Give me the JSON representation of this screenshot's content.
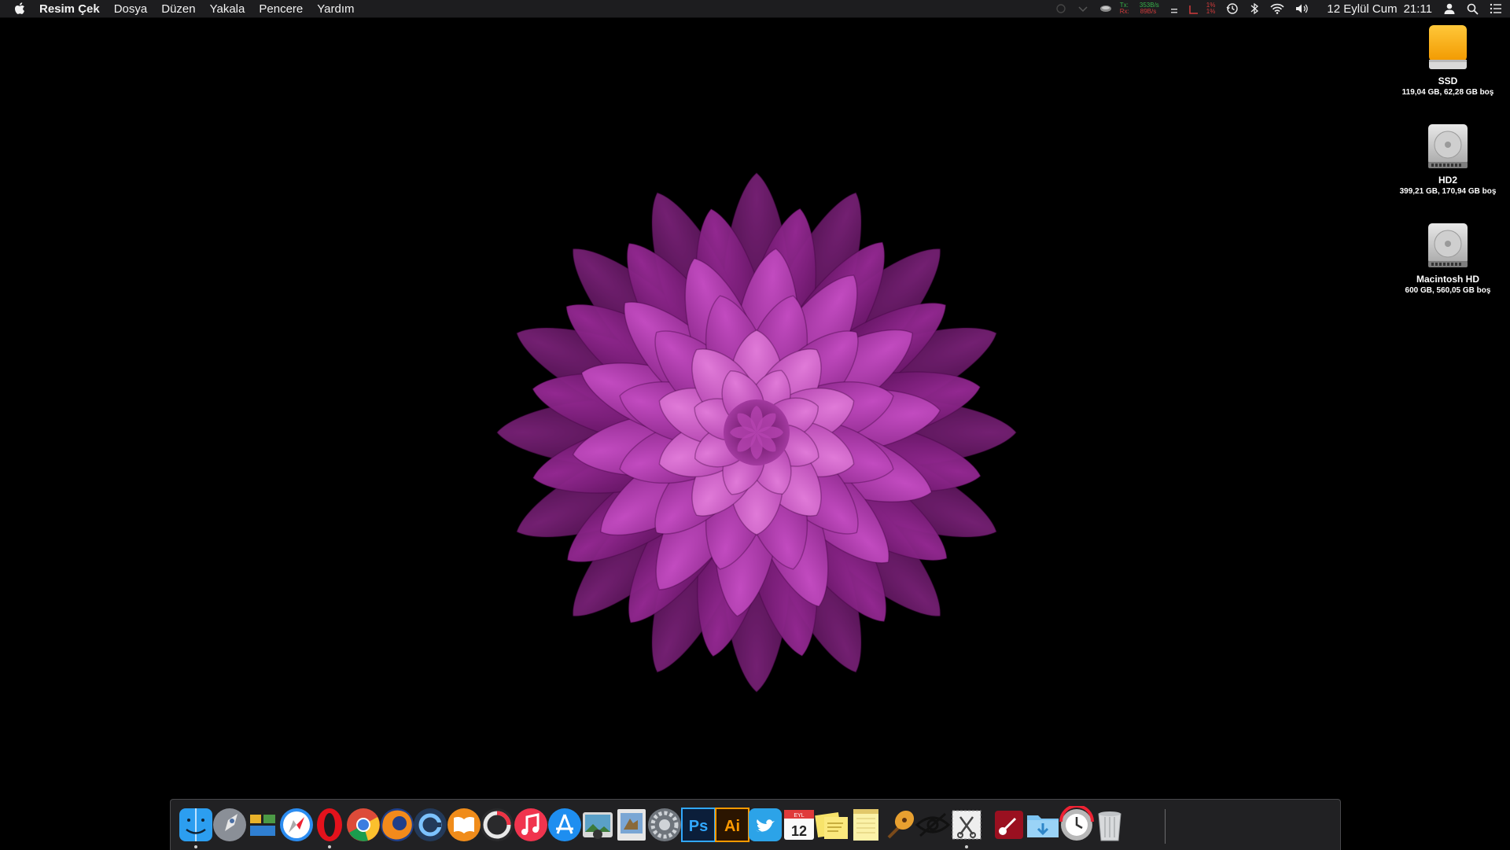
{
  "menubar": {
    "app_name": "Resim Çek",
    "items": [
      "Dosya",
      "Düzen",
      "Yakala",
      "Pencere",
      "Yardım"
    ],
    "network": {
      "tx_label": "Tx:",
      "rx_label": "Rx:",
      "tx_value": "353B/s",
      "rx_value": "89B/s"
    },
    "cpu": {
      "line1": "1%",
      "line2": "1%"
    },
    "date": "12 Eylül Cum",
    "time": "21:11"
  },
  "desktop": {
    "drives": [
      {
        "name": "SSD",
        "info": "119,04 GB, 62,28 GB boş",
        "icon": "external-drive-icon"
      },
      {
        "name": "HD2",
        "info": "399,21 GB, 170,94 GB boş",
        "icon": "hard-drive-icon"
      },
      {
        "name": "Macintosh HD",
        "info": "600 GB, 560,05 GB boş",
        "icon": "hard-drive-icon"
      }
    ]
  },
  "dock": {
    "apps": [
      {
        "name": "Finder",
        "icon": "finder-icon",
        "running": true
      },
      {
        "name": "Launchpad",
        "icon": "launchpad-icon",
        "running": false
      },
      {
        "name": "Mission Control",
        "icon": "mission-control-icon",
        "running": false
      },
      {
        "name": "Safari",
        "icon": "safari-icon",
        "running": false
      },
      {
        "name": "Opera",
        "icon": "opera-icon",
        "running": true
      },
      {
        "name": "Chrome",
        "icon": "chrome-icon",
        "running": false
      },
      {
        "name": "Firefox",
        "icon": "firefox-icon",
        "running": false
      },
      {
        "name": "Web Browser",
        "icon": "browser-icon",
        "running": false
      },
      {
        "name": "iBooks",
        "icon": "ibooks-icon",
        "running": false
      },
      {
        "name": "Music Player",
        "icon": "music-player-icon",
        "running": false
      },
      {
        "name": "iTunes",
        "icon": "itunes-icon",
        "running": false
      },
      {
        "name": "App Store",
        "icon": "app-store-icon",
        "running": false
      },
      {
        "name": "Image Capture",
        "icon": "image-capture-icon",
        "running": false
      },
      {
        "name": "Preview",
        "icon": "preview-icon",
        "running": false
      },
      {
        "name": "System Preferences",
        "icon": "system-preferences-icon",
        "running": false
      },
      {
        "name": "Photoshop",
        "icon": "photoshop-icon",
        "running": false,
        "label": "Ps"
      },
      {
        "name": "Illustrator",
        "icon": "illustrator-icon",
        "running": false,
        "label": "Ai"
      },
      {
        "name": "Twitter",
        "icon": "twitter-icon",
        "running": false
      },
      {
        "name": "Calendar",
        "icon": "calendar-icon",
        "running": false,
        "label": "12",
        "month": "EYL"
      },
      {
        "name": "Stickies",
        "icon": "stickies-icon",
        "running": false
      },
      {
        "name": "Notes",
        "icon": "notes-icon",
        "running": false
      },
      {
        "name": "GarageBand",
        "icon": "garageband-icon",
        "running": false
      },
      {
        "name": "Privacy Eye",
        "icon": "eye-icon",
        "running": false
      },
      {
        "name": "Screenshot",
        "icon": "screenshot-icon",
        "running": true
      },
      {
        "name": "Guitar Pro",
        "icon": "guitar-pro-icon",
        "running": false
      },
      {
        "name": "Downloads",
        "icon": "downloads-folder-icon",
        "running": false
      },
      {
        "name": "Time Machine",
        "icon": "time-machine-icon",
        "running": false
      },
      {
        "name": "Trash",
        "icon": "trash-icon",
        "running": false
      }
    ]
  },
  "colors": {
    "wallpaper_flower": "#b83cb8",
    "menubar_bg": "#1d1d1f",
    "accent_green": "#38b24a",
    "accent_red": "#d23b3b"
  }
}
